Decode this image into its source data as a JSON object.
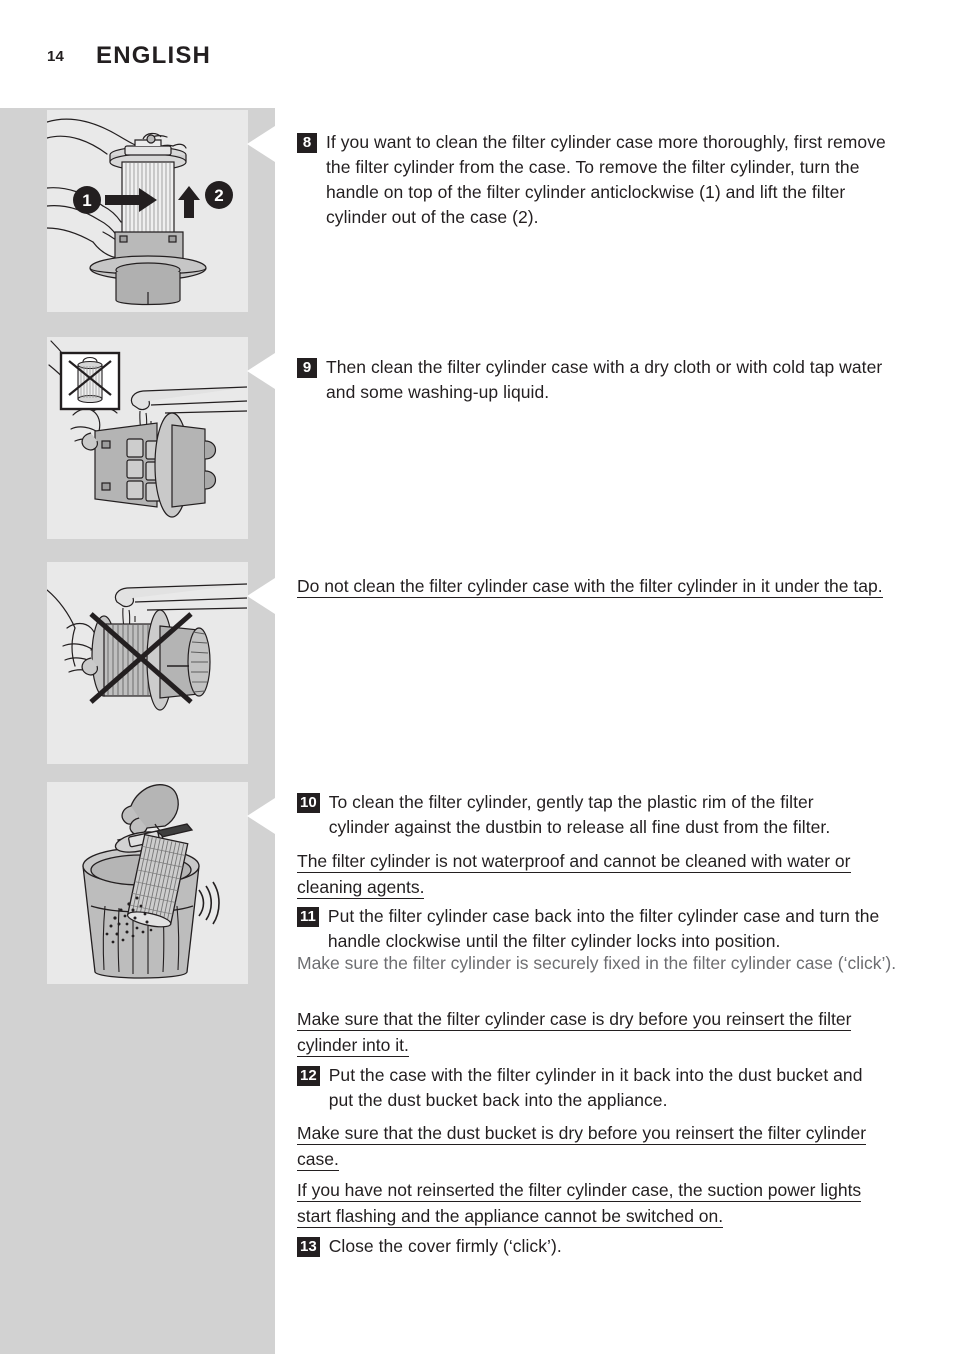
{
  "header": {
    "page_number": "14",
    "title": "ENGLISH"
  },
  "figures": [
    {
      "id": "figure-remove-filter-cylinder",
      "caption_icons": [
        "arrow-right-1",
        "arrow-up-2"
      ],
      "labels": [
        "1",
        "2"
      ],
      "description": "Hands turning the handle on top of the filter cylinder anticlockwise and lifting it out of the case"
    },
    {
      "id": "figure-clean-case-under-tap",
      "labels": [],
      "description": "Filter cylinder case rinsed under a running tap, with inset showing crossed-out filter cylinder"
    },
    {
      "id": "figure-do-not-clean-assembly",
      "labels": [],
      "description": "Crossed-out illustration of the filter cylinder case with the filter cylinder in it held under the tap"
    },
    {
      "id": "figure-tap-cylinder-dustbin",
      "labels": [],
      "description": "Hand tapping the plastic rim of the filter cylinder against a dustbin to release fine dust"
    }
  ],
  "steps": [
    {
      "number": "8",
      "text": "If you want to clean the filter cylinder case more thoroughly, first remove the filter cylinder from the case. To remove the filter cylinder, turn the handle on top of the filter cylinder anticlockwise (1) and lift the filter cylinder out of the case (2)."
    },
    {
      "number": "9",
      "text": "Then clean the filter cylinder case with a dry cloth or with cold tap water and some washing-up liquid."
    },
    {
      "number": "10",
      "text": "To clean the filter cylinder, gently tap the plastic rim of the filter cylinder against the dustbin to release all fine dust from the filter."
    },
    {
      "number": "11",
      "text": "Put the filter cylinder case back into the filter cylinder case and turn the handle clockwise until the filter cylinder locks into position."
    },
    {
      "number": "12",
      "text": "Put the case with the filter cylinder in it back into the dust bucket and put the dust bucket back into the appliance."
    },
    {
      "number": "13",
      "text": "Close the cover firmly (‘click’)."
    }
  ],
  "notes": {
    "do_not_clean_under_tap": "Do not clean the filter cylinder case with the filter cylinder in it under the tap.",
    "not_waterproof": "The filter cylinder is not waterproof and cannot be cleaned with water or cleaning agents.",
    "securely_fixed": "Make sure the filter cylinder is securely fixed in the filter cylinder case (‘click’).",
    "case_dry": "Make sure that the filter cylinder case is dry before you reinsert the filter cylinder into it.",
    "bucket_dry": "Make sure that the dust bucket is dry before you reinsert the filter cylinder case.",
    "suction_lights": "If you have not reinserted the filter cylinder case, the suction power lights start flashing and the appliance cannot be switched on."
  },
  "colors": {
    "band": "#d2d2d2",
    "figure_bg": "#e9e9e9",
    "text": "#231f20",
    "muted_text": "#6d6e71",
    "badge_bg": "#231f20"
  }
}
